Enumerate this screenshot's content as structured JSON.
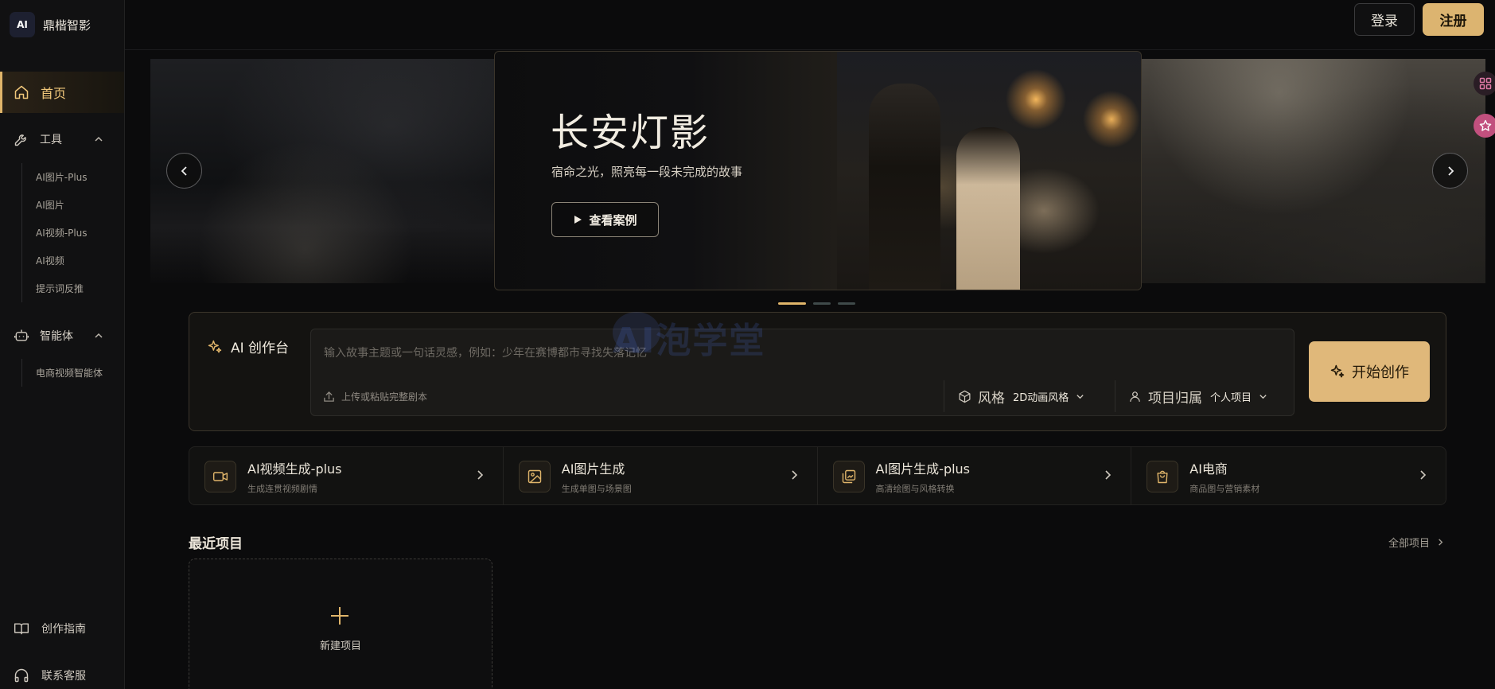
{
  "brand": {
    "logo_text": "AI",
    "name": "鼎楷智影"
  },
  "header": {
    "login_label": "登录",
    "register_label": "注册"
  },
  "sidebar": {
    "home_label": "首页",
    "tools_label": "工具",
    "tools_items": [
      "AI图片-Plus",
      "AI图片",
      "AI视频-Plus",
      "AI视频",
      "提示词反推"
    ],
    "agents_label": "智能体",
    "agents_items": [
      "电商视频智能体"
    ],
    "guide_label": "创作指南",
    "support_label": "联系客服"
  },
  "carousel": {
    "title": "长安灯影",
    "subtitle": "宿命之光，照亮每一段未完成的故事",
    "button_label": "查看案例",
    "slide_count": 3,
    "active_index": 0
  },
  "create": {
    "title": "AI 创作台",
    "input_placeholder": "输入故事主题或一句话灵感，例如：少年在赛博都市寻找失落记忆",
    "upload_label": "上传或粘贴完整剧本",
    "style_key": "风格",
    "style_value": "2D动画风格",
    "owner_key": "项目归属",
    "owner_value": "个人项目",
    "start_label": "开始创作"
  },
  "watermark": "AI泡学堂",
  "tools": [
    {
      "title": "AI视频生成-plus",
      "subtitle": "生成连贯视频剧情",
      "icon": "video-icon"
    },
    {
      "title": "AI图片生成",
      "subtitle": "生成单图与场景图",
      "icon": "image-icon"
    },
    {
      "title": "AI图片生成-plus",
      "subtitle": "高清绘图与风格转换",
      "icon": "gallery-icon"
    },
    {
      "title": "AI电商",
      "subtitle": "商品图与营销素材",
      "icon": "shopping-bag-icon"
    }
  ],
  "recent": {
    "title": "最近项目",
    "all_label": "全部项目",
    "new_label": "新建项目"
  },
  "colors": {
    "accent": "#e0b56a",
    "background": "#0b0b0c",
    "sidebar": "#111112"
  }
}
